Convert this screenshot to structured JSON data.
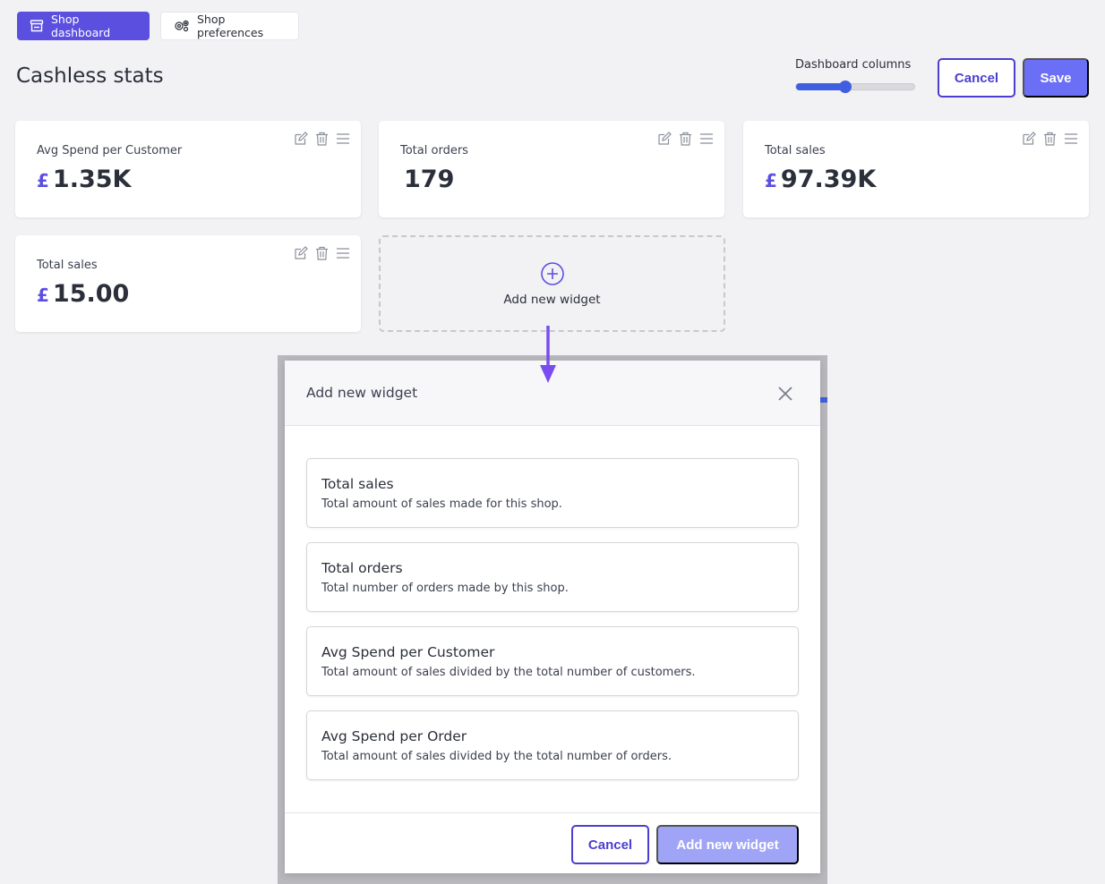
{
  "tabs": [
    {
      "label": "Shop dashboard",
      "icon": "shop-icon"
    },
    {
      "label": "Shop preferences",
      "icon": "settings-icon"
    }
  ],
  "page": {
    "title": "Cashless stats"
  },
  "header": {
    "columns_label": "Dashboard columns",
    "columns_slider_value": 0.42,
    "cancel_label": "Cancel",
    "save_label": "Save"
  },
  "widgets": [
    {
      "label": "Avg Spend per Customer",
      "currency": "£",
      "value": "1.35K"
    },
    {
      "label": "Total orders",
      "currency": "",
      "value": "179"
    },
    {
      "label": "Total sales",
      "currency": "£",
      "value": "97.39K"
    },
    {
      "label": "Total sales",
      "currency": "£",
      "value": "15.00"
    }
  ],
  "add_tile": {
    "label": "Add new widget"
  },
  "modal": {
    "title": "Add new widget",
    "options": [
      {
        "title": "Total sales",
        "desc": "Total amount of sales made for this shop."
      },
      {
        "title": "Total orders",
        "desc": "Total number of orders made by this shop."
      },
      {
        "title": "Avg Spend per Customer",
        "desc": "Total amount of sales divided by the total number of customers."
      },
      {
        "title": "Avg Spend per Order",
        "desc": "Total amount of sales divided by the total number of orders."
      }
    ],
    "cancel_label": "Cancel",
    "add_label": "Add new widget"
  },
  "colors": {
    "primary": "#5b4fe0",
    "button_blue": "#6b6ff5",
    "button_disabled": "#9fa4f7",
    "slider": "#3f5fe0"
  }
}
